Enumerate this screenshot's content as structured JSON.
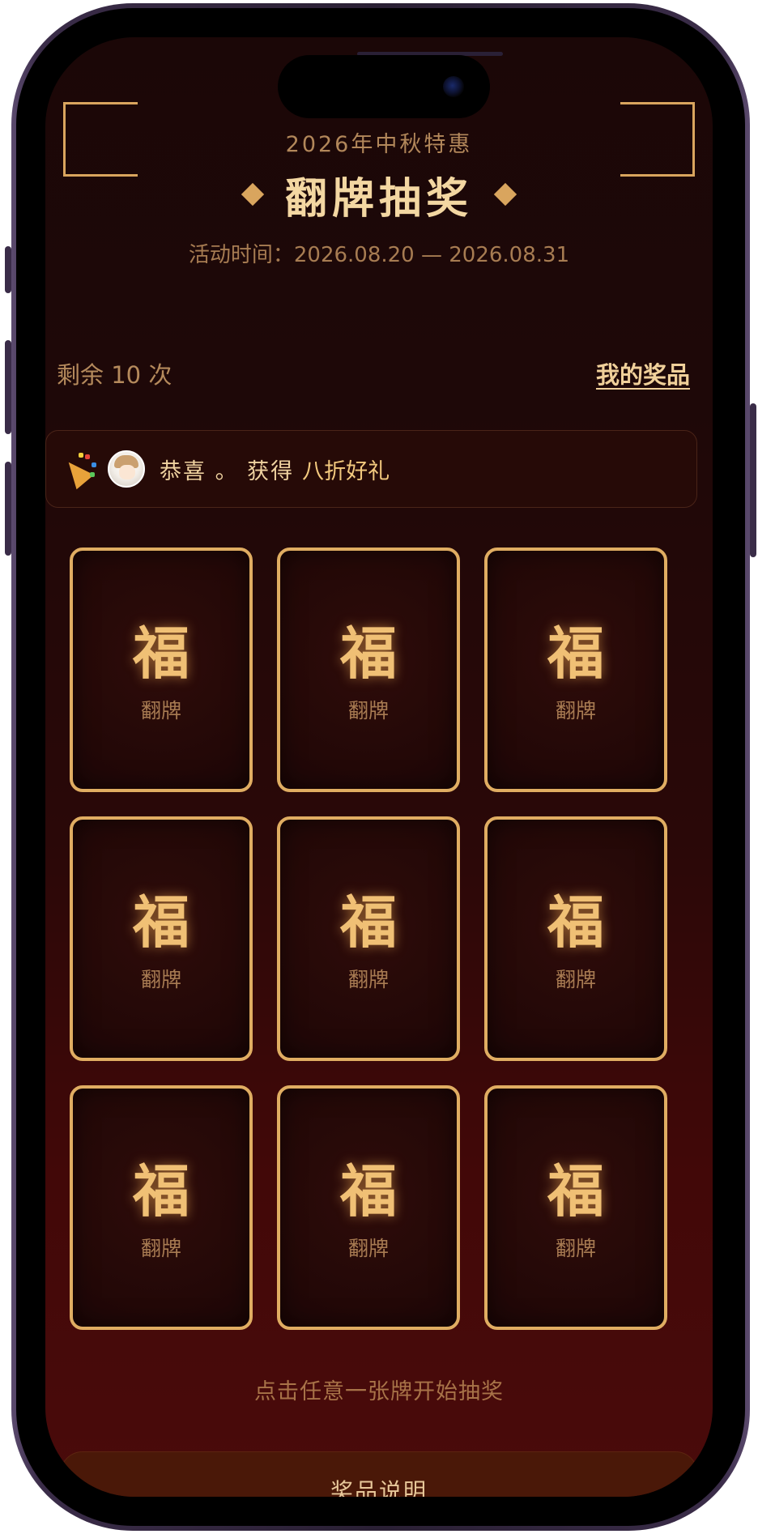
{
  "header": {
    "subtitle": "2026年中秋特惠",
    "title": "翻牌抽奖",
    "period": "活动时间：2026.08.20 — 2026.08.31"
  },
  "status": {
    "remaining": "剩余 10 次",
    "my_prizes": "我的奖品"
  },
  "marquee": {
    "text": "恭喜 。 获得",
    "prize": "八折好礼"
  },
  "cards": [
    {
      "glyph": "福",
      "label": "翻牌"
    },
    {
      "glyph": "福",
      "label": "翻牌"
    },
    {
      "glyph": "福",
      "label": "翻牌"
    },
    {
      "glyph": "福",
      "label": "翻牌"
    },
    {
      "glyph": "福",
      "label": "翻牌"
    },
    {
      "glyph": "福",
      "label": "翻牌"
    },
    {
      "glyph": "福",
      "label": "翻牌"
    },
    {
      "glyph": "福",
      "label": "翻牌"
    },
    {
      "glyph": "福",
      "label": "翻牌"
    }
  ],
  "hint": "点击任意一张牌开始抽奖",
  "prize_explain": "奖品说明",
  "colors": {
    "gold": "#e0ad62",
    "title_gold": "#f3d7a2",
    "bg_dark": "#1b0707",
    "bg_red": "#4a0b0b"
  }
}
